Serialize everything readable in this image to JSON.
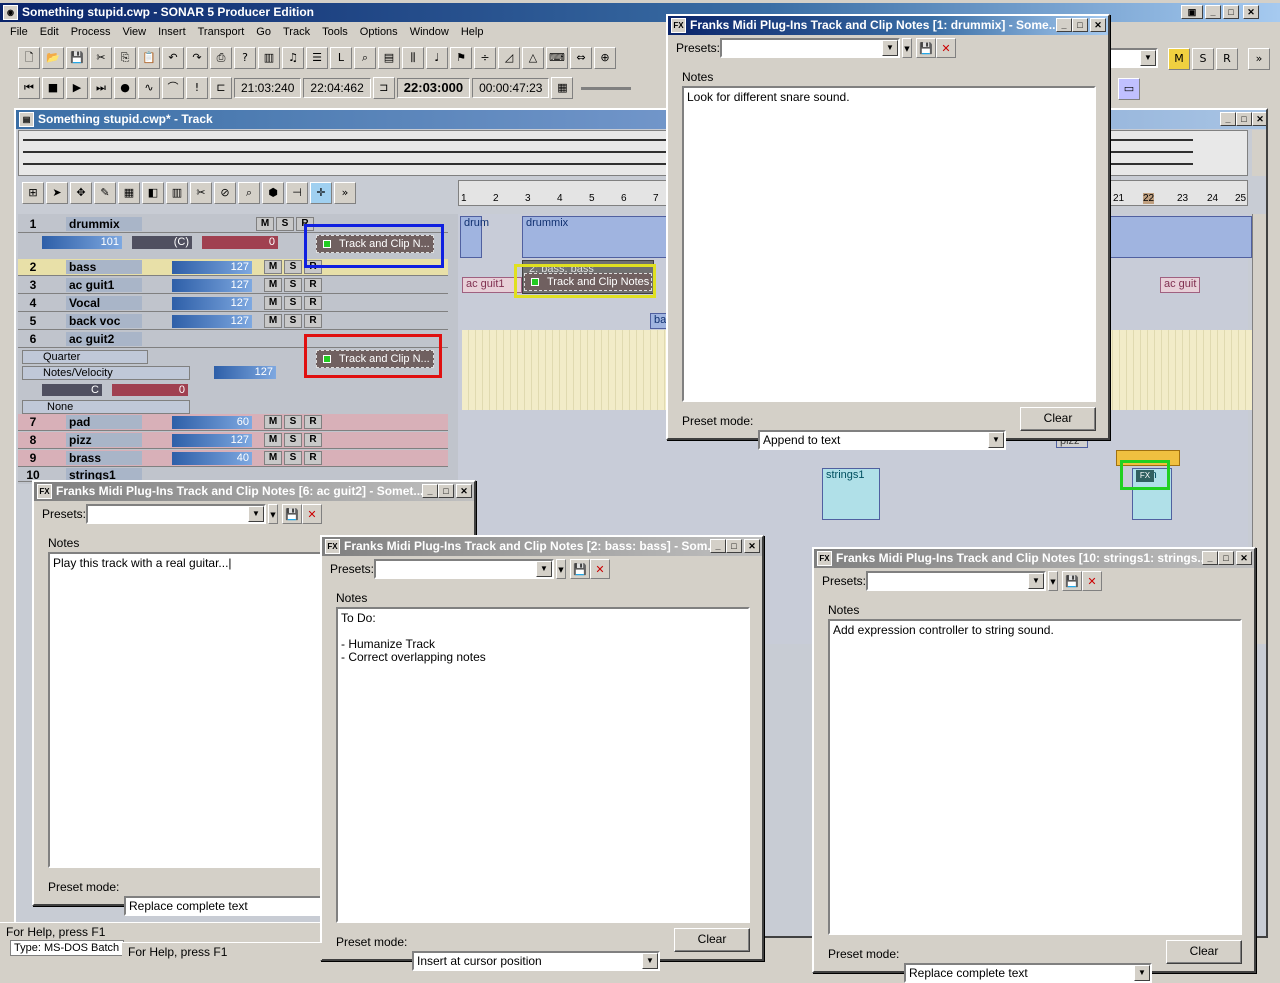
{
  "app": {
    "title": "Something stupid.cwp - SONAR 5 Producer Edition",
    "menu": [
      "File",
      "Edit",
      "Process",
      "View",
      "Insert",
      "Transport",
      "Go",
      "Track",
      "Tools",
      "Options",
      "Window",
      "Help"
    ],
    "time_from": "21:03:240",
    "time_to": "22:04:462",
    "now_time": "22:03:000",
    "mbt": "00:00:47:23",
    "right_toggles": [
      "M",
      "S",
      "R"
    ]
  },
  "track_view": {
    "title": "Something stupid.cwp* - Track",
    "ruler": [
      "1",
      "2",
      "3",
      "4",
      "5",
      "6",
      "7",
      "21",
      "22",
      "23",
      "24",
      "25"
    ],
    "tracks": [
      {
        "num": "1",
        "name": "drummix",
        "vol": "101",
        "pan": "(C)",
        "sub": "0"
      },
      {
        "num": "2",
        "name": "bass",
        "vol": "127"
      },
      {
        "num": "3",
        "name": "ac guit1",
        "vol": "127"
      },
      {
        "num": "4",
        "name": "Vocal",
        "vol": "127"
      },
      {
        "num": "5",
        "name": "back voc",
        "vol": "127"
      },
      {
        "num": "6",
        "name": "ac guit2",
        "quantize": "Quarter",
        "mode": "Notes/Velocity",
        "vel": "127",
        "pan": "C",
        "sub": "0",
        "input": "None"
      },
      {
        "num": "7",
        "name": "pad",
        "vol": "60"
      },
      {
        "num": "8",
        "name": "pizz",
        "vol": "127"
      },
      {
        "num": "9",
        "name": "brass",
        "vol": "40"
      },
      {
        "num": "10",
        "name": "strings1"
      }
    ],
    "msr": [
      "M",
      "S",
      "R"
    ],
    "plugin_label": "Track and Clip N...",
    "clip_plugin_label": "Track and Clip Notes",
    "clip_plugin_title": "2: bass: bass",
    "clips": [
      "drum",
      "drummix",
      "ac guit1",
      "ac guit",
      "strings1",
      "pizz",
      "strin",
      "ba"
    ],
    "fx_label": "FX"
  },
  "dialogs": {
    "drummix": {
      "title": "Franks Midi Plug-Ins Track and Clip Notes [1: drummix] - Some...",
      "presets_label": "Presets:",
      "notes_label": "Notes",
      "notes": "Look for different snare sound.",
      "preset_mode_label": "Preset mode:",
      "preset_mode": "Append to text",
      "clear": "Clear"
    },
    "acguit2": {
      "title": "Franks Midi Plug-Ins Track and Clip Notes [6: ac guit2] - Somet...",
      "presets_label": "Presets:",
      "notes_label": "Notes",
      "notes": "Play this track with a real guitar...|",
      "preset_mode_label": "Preset mode:",
      "preset_mode": "Replace complete text"
    },
    "bass": {
      "title": "Franks Midi Plug-Ins Track and Clip Notes [2: bass: bass] - Som...",
      "presets_label": "Presets:",
      "notes_label": "Notes",
      "notes": "To Do:\n\n- Humanize Track\n- Correct overlapping notes",
      "preset_mode_label": "Preset mode:",
      "preset_mode": "Insert at cursor position",
      "clear": "Clear"
    },
    "strings": {
      "title": "Franks Midi Plug-Ins Track and Clip Notes [10: strings1: strings...",
      "presets_label": "Presets:",
      "notes_label": "Notes",
      "notes": "Add expression controller to string sound.",
      "preset_mode_label": "Preset mode:",
      "preset_mode": "Replace complete text",
      "clear": "Clear"
    }
  },
  "status": {
    "help1": "For Help, press F1",
    "help2": "For Help, press F1",
    "type": "Type: MS-DOS Batch F"
  },
  "colors": {
    "title_active": "#0a246a",
    "track_name": "#a9b5c8",
    "plugin_bg": "#706060",
    "highlight_blue": "#1020e0",
    "highlight_red": "#e01010",
    "highlight_yellow": "#e0e020",
    "highlight_green": "#20d020"
  }
}
